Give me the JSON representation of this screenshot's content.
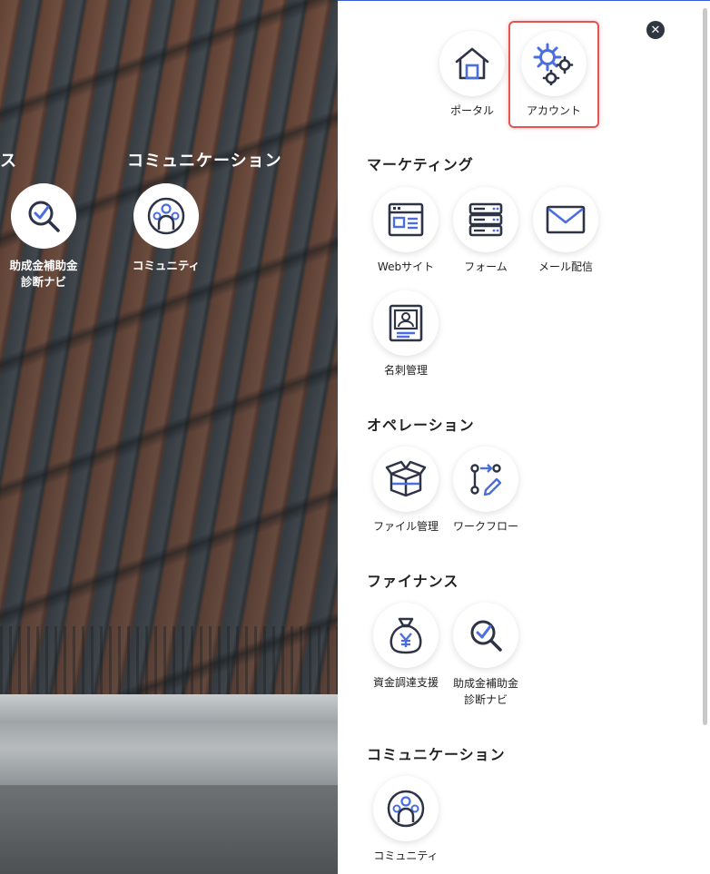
{
  "background": {
    "partial_category": "ス",
    "category": "コミュニケーション",
    "items": [
      {
        "label_line1": "助成金補助金",
        "label_line2": "診断ナビ",
        "icon": "check-magnifier-icon"
      },
      {
        "label": "コミュニティ",
        "icon": "community-icon"
      }
    ]
  },
  "panel": {
    "close_label": "✕",
    "top_apps": [
      {
        "label": "ポータル",
        "icon": "home-icon"
      },
      {
        "label": "アカウント",
        "icon": "gears-icon",
        "highlighted": true
      }
    ],
    "sections": [
      {
        "title": "マーケティング",
        "apps": [
          {
            "label": "Webサイト",
            "icon": "website-icon"
          },
          {
            "label": "フォーム",
            "icon": "form-icon"
          },
          {
            "label": "メール配信",
            "icon": "mail-icon"
          },
          {
            "label": "名刺管理",
            "icon": "business-card-icon"
          }
        ]
      },
      {
        "title": "オペレーション",
        "apps": [
          {
            "label": "ファイル管理",
            "icon": "box-icon"
          },
          {
            "label": "ワークフロー",
            "icon": "workflow-icon"
          }
        ]
      },
      {
        "title": "ファイナンス",
        "apps": [
          {
            "label": "資金調達支援",
            "icon": "money-bag-icon"
          },
          {
            "label_line1": "助成金補助金",
            "label_line2": "診断ナビ",
            "icon": "check-magnifier-icon"
          }
        ]
      },
      {
        "title": "コミュニケーション",
        "apps": [
          {
            "label": "コミュニティ",
            "icon": "community-icon"
          }
        ]
      }
    ]
  },
  "colors": {
    "accent_blue": "#4a6ee0",
    "icon_dark": "#2e3446",
    "highlight_red": "#e55353"
  }
}
